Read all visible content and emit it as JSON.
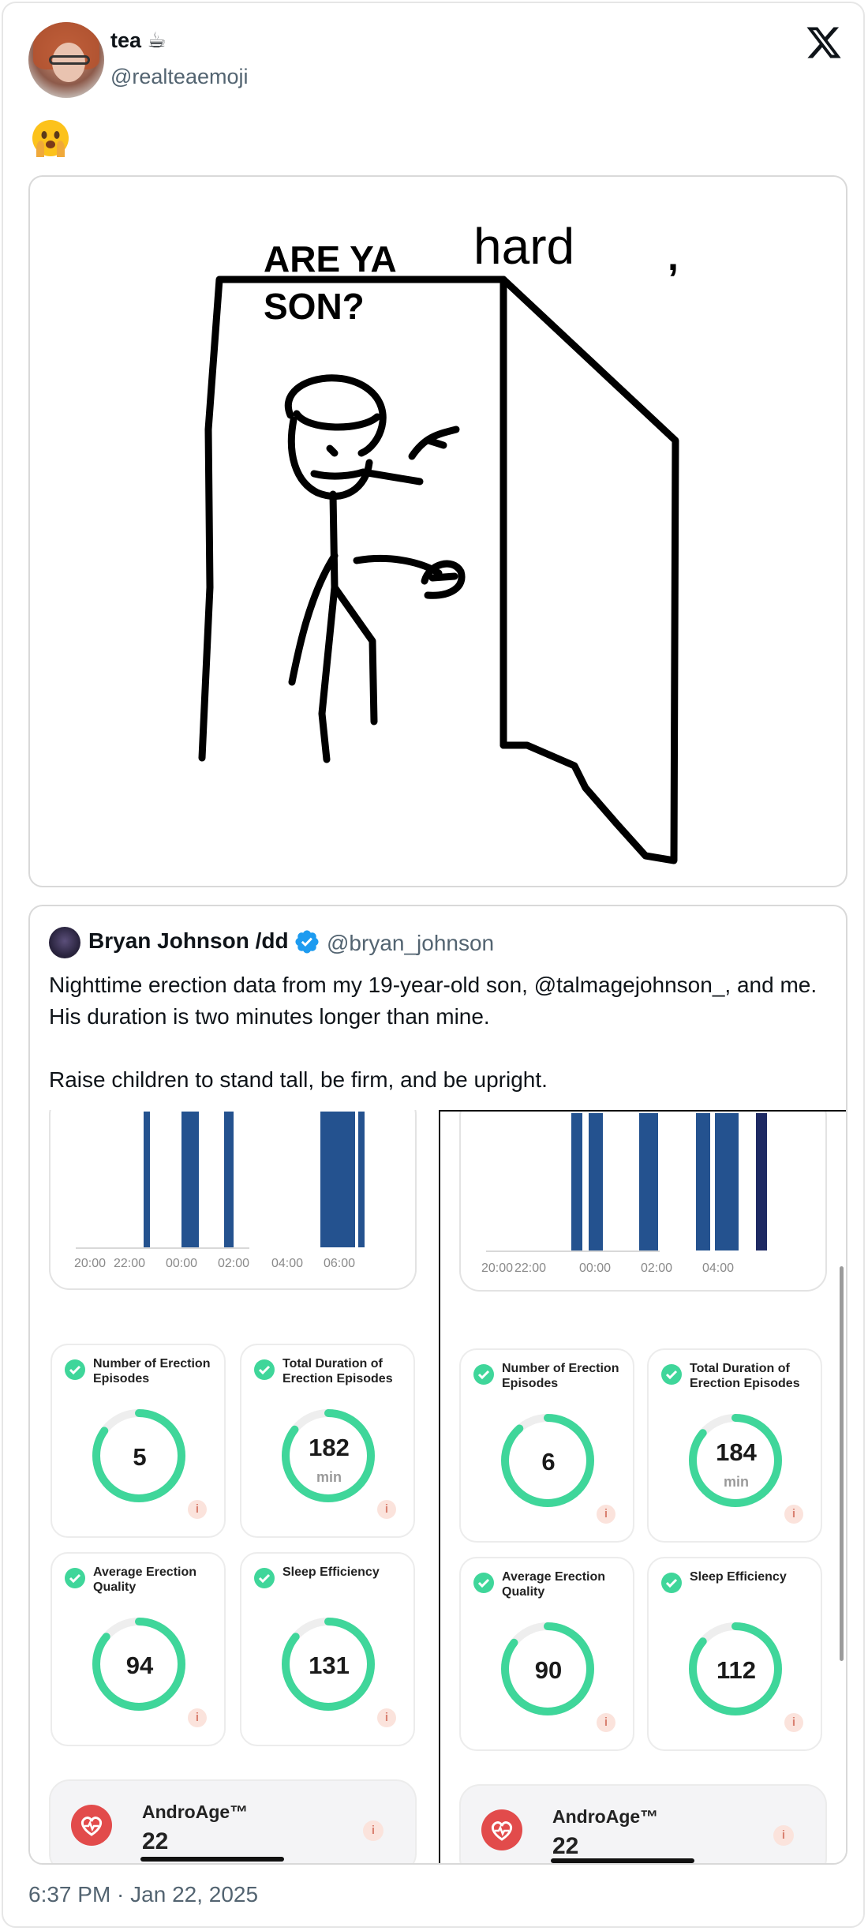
{
  "tweet": {
    "author_name": "tea",
    "author_emoji": "☕",
    "handle": "@realteaemoji",
    "body_emoji": "🫣",
    "timestamp": "6:37 PM · Jan 22, 2025"
  },
  "meme": {
    "line1": "ARE YA",
    "handwritten": "hard",
    "comma": ",",
    "line2": "SON?"
  },
  "quoted": {
    "author_name": "Bryan Johnson /dd",
    "handle": "@bryan_johnson",
    "text_p1": "Nighttime erection data from my 19-year-old son, @talmagejohnson_, and me. His duration is two minutes longer than mine.",
    "text_p2": "Raise children to stand tall, be firm, and be upright."
  },
  "left_panel": {
    "chart_ticks": [
      "20:00",
      "22:00",
      "00:00",
      "02:00",
      "04:00",
      "06:00"
    ],
    "stats": [
      {
        "label": "Number of Erection Episodes",
        "value": "5",
        "unit": ""
      },
      {
        "label": "Total Duration of Erection Episodes",
        "value": "182",
        "unit": "min"
      },
      {
        "label": "Average Erection Quality",
        "value": "94",
        "unit": ""
      },
      {
        "label": "Sleep Efficiency",
        "value": "131",
        "unit": ""
      }
    ],
    "andro_title": "AndroAge™",
    "andro_value": "22",
    "info": "i"
  },
  "right_panel": {
    "chart_ticks": [
      "20:00",
      "22:00",
      "00:00",
      "02:00",
      "04:00"
    ],
    "stats": [
      {
        "label": "Number of Erection Episodes",
        "value": "6",
        "unit": ""
      },
      {
        "label": "Total Duration of Erection Episodes",
        "value": "184",
        "unit": "min"
      },
      {
        "label": "Average Erection Quality",
        "value": "90",
        "unit": ""
      },
      {
        "label": "Sleep Efficiency",
        "value": "112",
        "unit": ""
      }
    ],
    "andro_title": "AndroAge™",
    "andro_value": "22",
    "info": "i"
  },
  "colors": {
    "bar_blue": "#24528f",
    "bar_navy": "#1e2a63",
    "ring_green": "#3fd69a",
    "verified_blue": "#1d9bf0",
    "heart_red": "#e24b4b"
  }
}
